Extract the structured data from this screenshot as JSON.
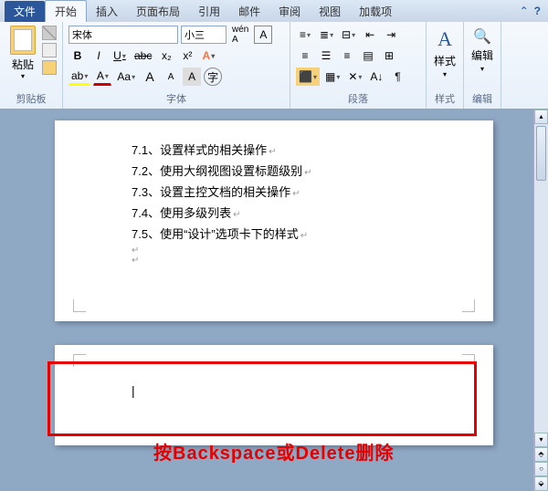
{
  "tabs": {
    "file": "文件",
    "home": "开始",
    "insert": "插入",
    "layout": "页面布局",
    "reference": "引用",
    "mail": "邮件",
    "review": "审阅",
    "view": "视图",
    "addins": "加载项"
  },
  "clipboard": {
    "paste": "粘贴",
    "label": "剪贴板"
  },
  "font": {
    "name": "宋体",
    "size": "小三",
    "label": "字体",
    "bold": "B",
    "italic": "I",
    "underline": "U",
    "strike": "abc",
    "sub": "x₂",
    "sup": "x²",
    "grow": "A",
    "shrink": "A",
    "aa": "Aa"
  },
  "para": {
    "label": "段落"
  },
  "styles": {
    "label": "样式",
    "btn": "样式"
  },
  "edit": {
    "label": "编辑",
    "btn": "编辑"
  },
  "doc": {
    "lines": [
      "7.1、设置样式的相关操作",
      "7.2、使用大纲视图设置标题级别",
      "7.3、设置主控文档的相关操作",
      "7.4、使用多级列表",
      "7.5、使用“设计”选项卡下的样式"
    ]
  },
  "annotation": "按Backspace或Delete删除"
}
